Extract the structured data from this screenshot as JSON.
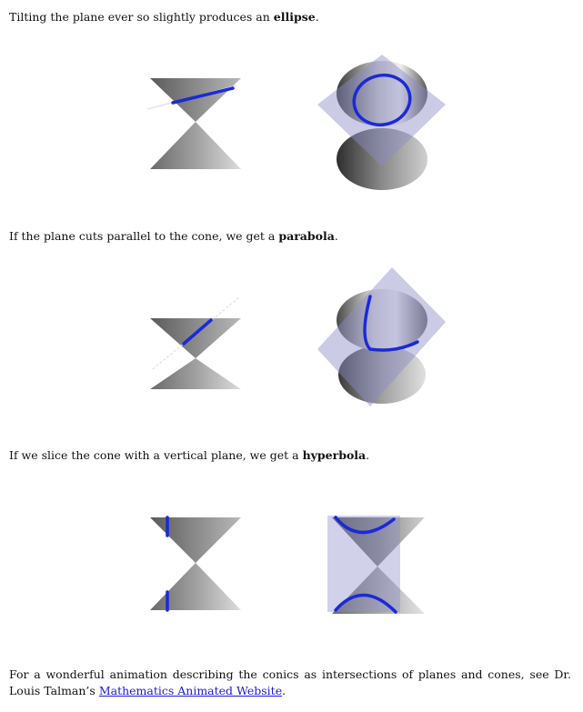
{
  "sections": [
    {
      "text_before": "Tilting the plane ever so slightly produces an ",
      "term": "ellipse",
      "text_after": "."
    },
    {
      "text_before": "If the plane cuts parallel to the cone, we get a ",
      "term": "parabola",
      "text_after": "."
    },
    {
      "text_before": "If we slice the cone with a vertical plane, we get a ",
      "term": "hyperbola",
      "text_after": "."
    }
  ],
  "footer": {
    "text_before": "For a wonderful animation describing the conics as intersections of planes and cones, see Dr. Louis Talman’s ",
    "link_text": "Mathematics Animated Website",
    "text_after": "."
  },
  "colors": {
    "curve": "#1a2ad6",
    "link": "#1a1ad8",
    "plane": "#8c8cc8"
  }
}
